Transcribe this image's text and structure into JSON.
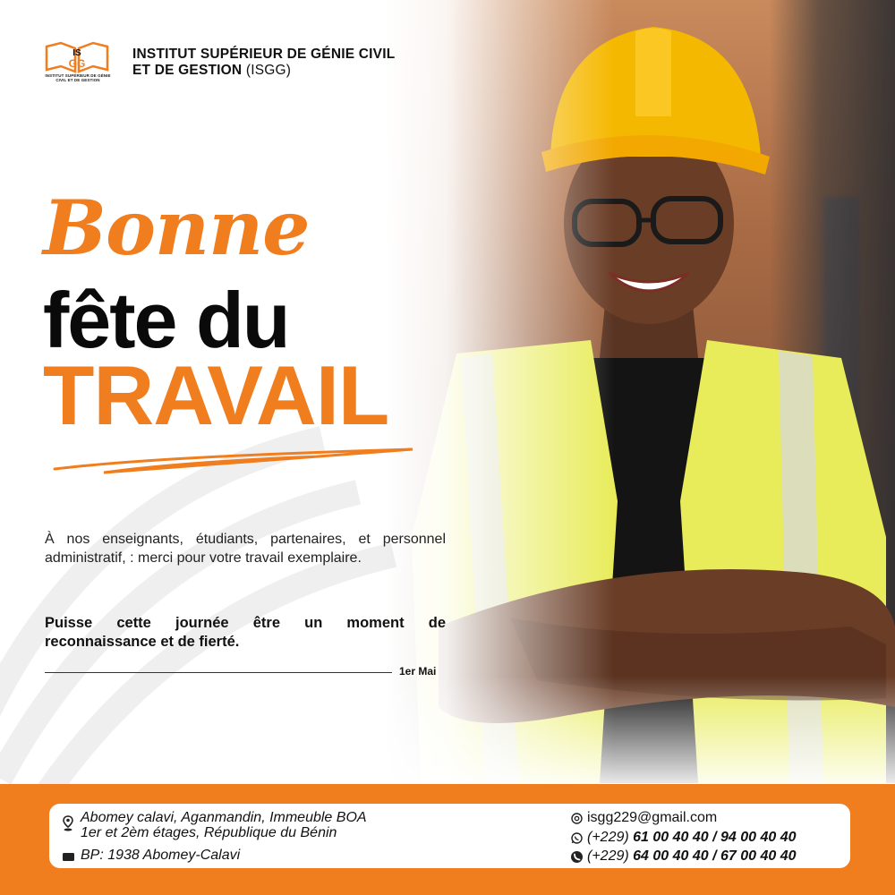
{
  "header": {
    "logo_text": "ISGG",
    "logo_caption": "INSTITUT SUPÉRIEUR DE GÉNIE CIVIL ET DE GESTION",
    "institution_line1": "INSTITUT SUPÉRIEUR DE GÉNIE CIVIL",
    "institution_line2": "ET DE GESTION",
    "institution_abbr": "(ISGG)"
  },
  "headline": {
    "line1": "Bonne",
    "line2": "fête du",
    "line3": "TRAVAIL"
  },
  "body": {
    "message": "À nos enseignants, étudiants, partenaires,  et personnel administratif, : merci pour votre travail exemplaire.",
    "emphasis_line1": "Puisse cette journée être un moment de",
    "emphasis_line2": "reconnaissance et de fierté.",
    "date": "1er Mai"
  },
  "footer": {
    "address_line1": "Abomey calavi, Aganmandin, Immeuble BOA",
    "address_line2": "1er et 2èm étages, République du Bénin",
    "po_box": "BP: 1938 Abomey-Calavi",
    "email": "isgg229@gmail.com",
    "phone1_prefix": "(+229)",
    "phone1_numbers": "61 00 40 40 / 94 00 40 40",
    "phone2_prefix": "(+229)",
    "phone2_numbers": "64 00 40 40 / 67 00 40 40"
  },
  "icons": {
    "address": "location-pin-icon",
    "po_box": "mailbox-icon",
    "email": "at-sign-icon",
    "whatsapp": "whatsapp-icon",
    "phone": "phone-icon"
  },
  "colors": {
    "accent": "#f07d1e",
    "text": "#111111",
    "hard_hat": "#f5b800",
    "vest": "#e8ec5a"
  }
}
